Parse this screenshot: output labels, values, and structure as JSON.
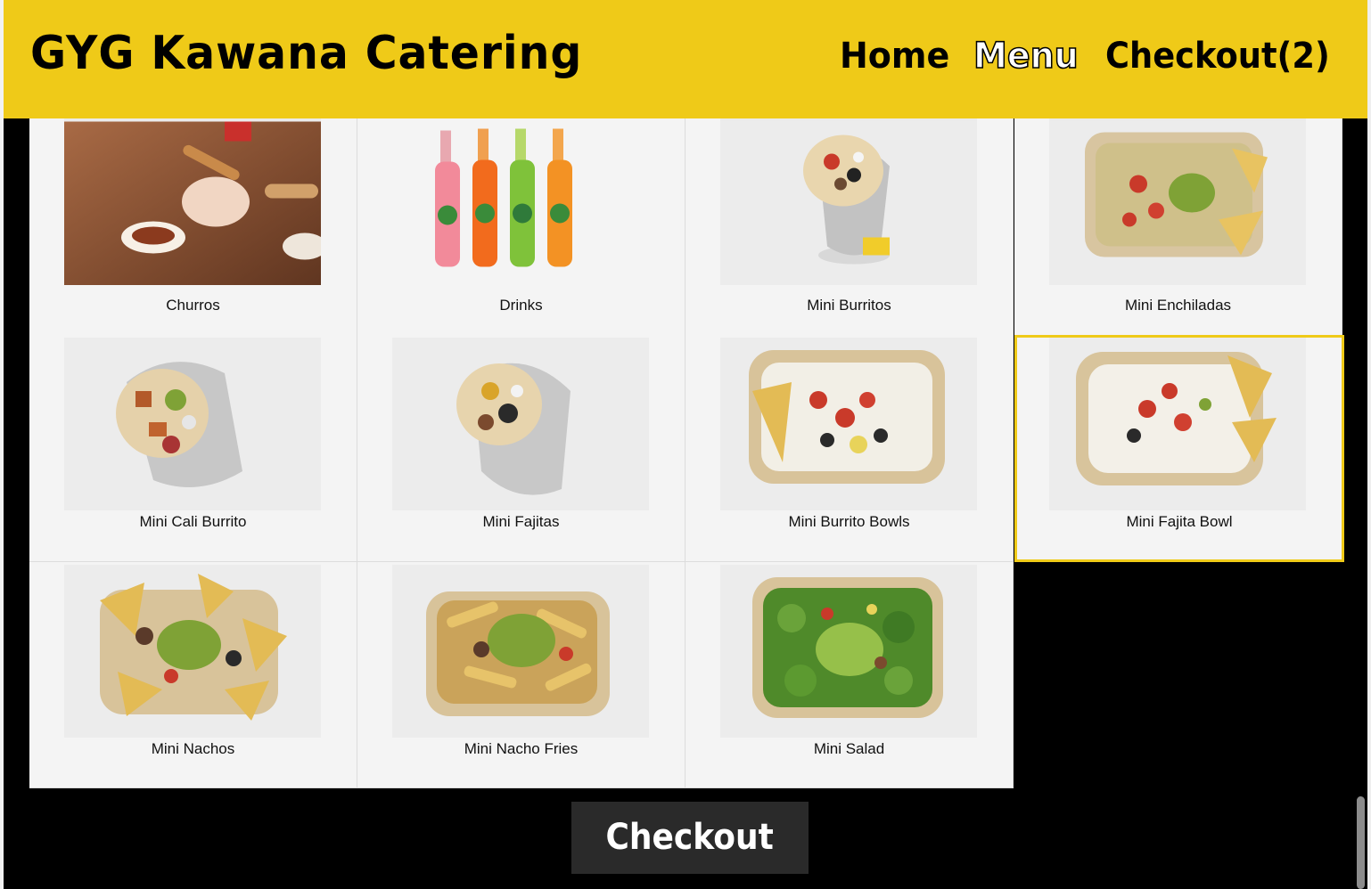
{
  "header": {
    "brand": "GYG Kawana Catering",
    "nav": {
      "home": "Home",
      "menu": "Menu",
      "checkout": "Checkout(2)"
    },
    "colors": {
      "bar": "#efca18",
      "text": "#000000"
    }
  },
  "menu_items": [
    {
      "label": "Churros",
      "image": "churros-photo",
      "selected": false
    },
    {
      "label": "Drinks",
      "image": "soda-bottles-photo",
      "selected": false
    },
    {
      "label": "Mini Burritos",
      "image": "burrito-photo",
      "selected": false
    },
    {
      "label": "Mini Enchiladas",
      "image": "enchilada-tray-photo",
      "selected": false
    },
    {
      "label": "Mini Cali Burrito",
      "image": "burrito-photo",
      "selected": false
    },
    {
      "label": "Mini Fajitas",
      "image": "burrito-photo",
      "selected": false
    },
    {
      "label": "Mini Burrito Bowls",
      "image": "bowl-photo",
      "selected": false
    },
    {
      "label": "Mini Fajita Bowl",
      "image": "bowl-photo",
      "selected": true
    },
    {
      "label": "Mini Nachos",
      "image": "nachos-photo",
      "selected": false
    },
    {
      "label": "Mini Nacho Fries",
      "image": "nacho-fries-photo",
      "selected": false
    },
    {
      "label": "Mini Salad",
      "image": "salad-photo",
      "selected": false
    }
  ],
  "checkout_button": {
    "label": "Checkout"
  },
  "colors": {
    "accent": "#efca18",
    "page_background": "#000000",
    "card_background": "#f4f4f4",
    "button_background": "#2a2a2a"
  }
}
